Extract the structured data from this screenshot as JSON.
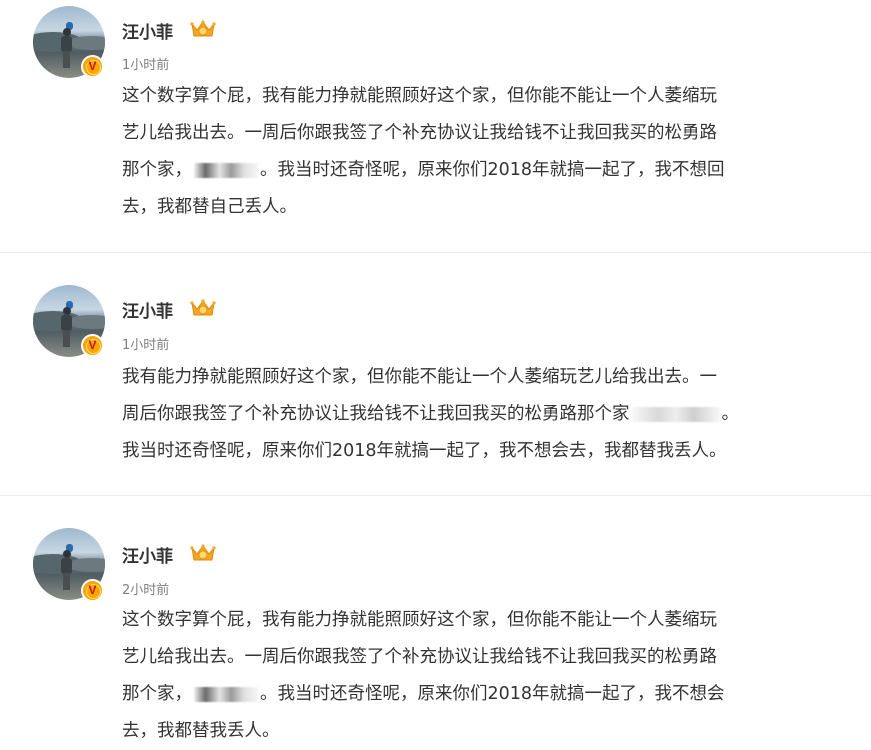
{
  "posts": [
    {
      "author": "汪小菲",
      "time": "1小时前",
      "lines": [
        "这个数字算个屁，我有能力挣就能照顾好这个家，但你能不能让一个人萎缩玩",
        "艺儿给我出去。一周后你跟我签了个补充协议让我给钱不让我回我买的松勇路",
        "那个家，",
        "。我当时还奇怪呢，原来你们2018年就搞一起了，我不想回",
        "去，我都替自己丢人。"
      ]
    },
    {
      "author": "汪小菲",
      "time": "1小时前",
      "lines": [
        "我有能力挣就能照顾好这个家，但你能不能让一个人萎缩玩艺儿给我出去。一",
        "周后你跟我签了个补充协议让我给钱不让我回我买的松勇路那个家",
        "。",
        "我当时还奇怪呢，原来你们2018年就搞一起了，我不想会去，我都替我丢人。"
      ]
    },
    {
      "author": "汪小菲",
      "time": "2小时前",
      "lines": [
        "这个数字算个屁，我有能力挣就能照顾好这个家，但你能不能让一个人萎缩玩",
        "艺儿给我出去。一周后你跟我签了个补充协议让我给钱不让我回我买的松勇路",
        "那个家，",
        "。我当时还奇怪呢，原来你们2018年就搞一起了，我不想会",
        "去，我都替我丢人。"
      ]
    }
  ],
  "icons": {
    "verified_badge": "v-badge-icon",
    "vip_crown": "crown-icon"
  },
  "colors": {
    "verified": "#ffa500",
    "crown": "#f5a623",
    "time": "#808080",
    "text": "#333333",
    "divider": "#ebebeb"
  }
}
